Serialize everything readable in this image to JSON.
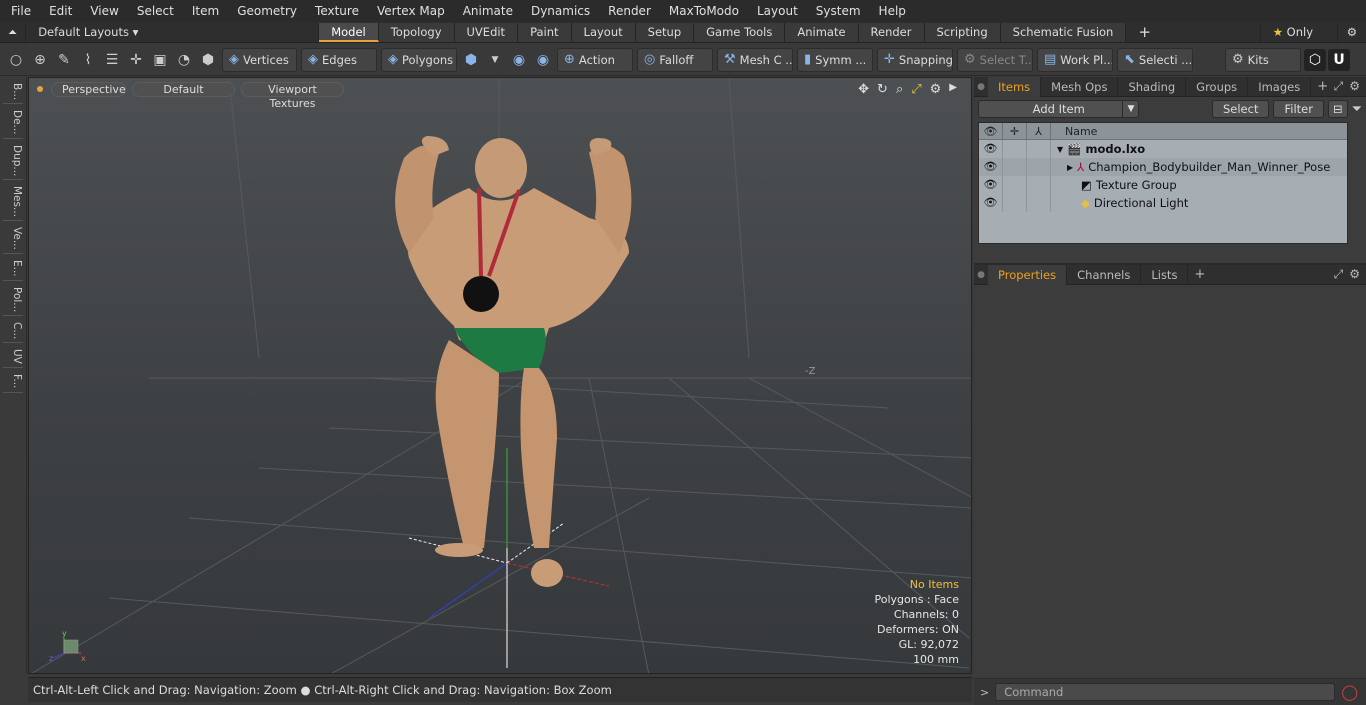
{
  "menu": [
    "File",
    "Edit",
    "View",
    "Select",
    "Item",
    "Geometry",
    "Texture",
    "Vertex Map",
    "Animate",
    "Dynamics",
    "Render",
    "MaxToModo",
    "Layout",
    "System",
    "Help"
  ],
  "layout": {
    "preset": "Default Layouts ▾",
    "tabs": [
      "Model",
      "Topology",
      "UVEdit",
      "Paint",
      "Layout",
      "Setup",
      "Game Tools",
      "Animate",
      "Render",
      "Scripting",
      "Schematic Fusion"
    ],
    "active_tab": "Model",
    "only_label": "Only"
  },
  "toolbar": {
    "vertices": "Vertices",
    "edges": "Edges",
    "polygons": "Polygons",
    "action": "Action",
    "falloff": "Falloff",
    "mesh": "Mesh C ...",
    "symm": "Symm ...",
    "snapping": "Snapping",
    "select_t": "Select T...",
    "work_pl": "Work Pl...",
    "selecti": "Selecti ...",
    "kits": "Kits"
  },
  "left_strip": [
    "B...",
    "De...",
    "Dup...",
    "Mes...",
    "Ve...",
    "E...",
    "Pol...",
    "C...",
    "UV",
    "F..."
  ],
  "viewport": {
    "view": "Perspective",
    "shading": "Default",
    "textures": "Viewport Textures",
    "axis_label": "-Z",
    "stats": {
      "items": "No Items",
      "polygons": "Polygons : Face",
      "channels": "Channels: 0",
      "deformers": "Deformers: ON",
      "gl": "GL: 92,072",
      "scale": "100 mm"
    }
  },
  "status": "Ctrl-Alt-Left Click and Drag: Navigation: Zoom ● Ctrl-Alt-Right Click and Drag: Navigation: Box Zoom",
  "items_panel": {
    "tabs": [
      "Items",
      "Mesh Ops",
      "Shading",
      "Groups",
      "Images"
    ],
    "add_item": "Add Item",
    "select": "Select",
    "filter": "Filter",
    "name_col": "Name",
    "rows": [
      "modo.lxo",
      "Champion_Bodybuilder_Man_Winner_Pose",
      "Texture Group",
      "Directional Light"
    ]
  },
  "props_panel": {
    "tabs": [
      "Properties",
      "Channels",
      "Lists"
    ]
  },
  "command_placeholder": "Command"
}
